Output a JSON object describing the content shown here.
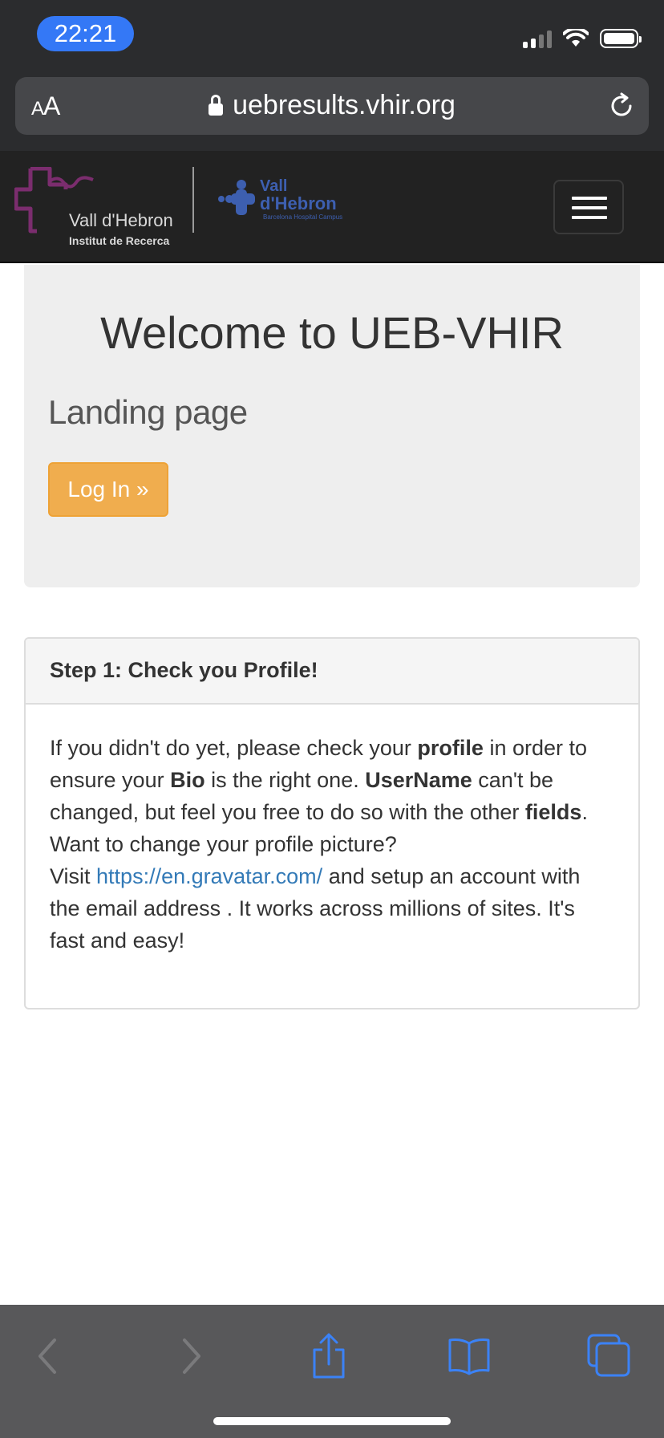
{
  "status_bar": {
    "time": "22:21"
  },
  "browser": {
    "text_size_label_small": "A",
    "text_size_label_large": "A",
    "url": "uebresults.vhir.org",
    "icons": [
      "lock-icon",
      "reload-icon"
    ]
  },
  "header": {
    "logo_vhir_name": "Vall d'Hebron",
    "logo_vhir_sub": "Institut de Recerca",
    "logo_campus_line1": "Vall",
    "logo_campus_line2": "d'Hebron",
    "logo_campus_line3": "Barcelona Hospital Campus",
    "colors": {
      "vhir_purple": "#7b2d6e",
      "campus_blue": "#3d5fb0"
    }
  },
  "jumbotron": {
    "title": "Welcome to UEB-VHIR",
    "lead": "Landing page",
    "login_label": "Log In »"
  },
  "panel": {
    "heading": "Step 1: Check you Profile!",
    "p1_a": "If you didn't do yet, please check your ",
    "p1_b": "profile",
    "p1_c": " in order to ensure your ",
    "p1_d": "Bio",
    "p1_e": " is the right one. ",
    "p1_f": "UserName",
    "p1_g": " can't be changed, but feel you free to do so with the other ",
    "p1_h": "fields",
    "p1_i": ".",
    "p2": "Want to change your profile picture?",
    "p3_a": "Visit ",
    "p3_link": "https://en.gravatar.com/",
    "p3_b": " and setup an account with the email address . It works across millions of sites. It's fast and easy!"
  },
  "toolbar": {
    "icons": [
      "back-icon",
      "forward-icon",
      "share-icon",
      "bookmarks-icon",
      "tabs-icon"
    ]
  }
}
